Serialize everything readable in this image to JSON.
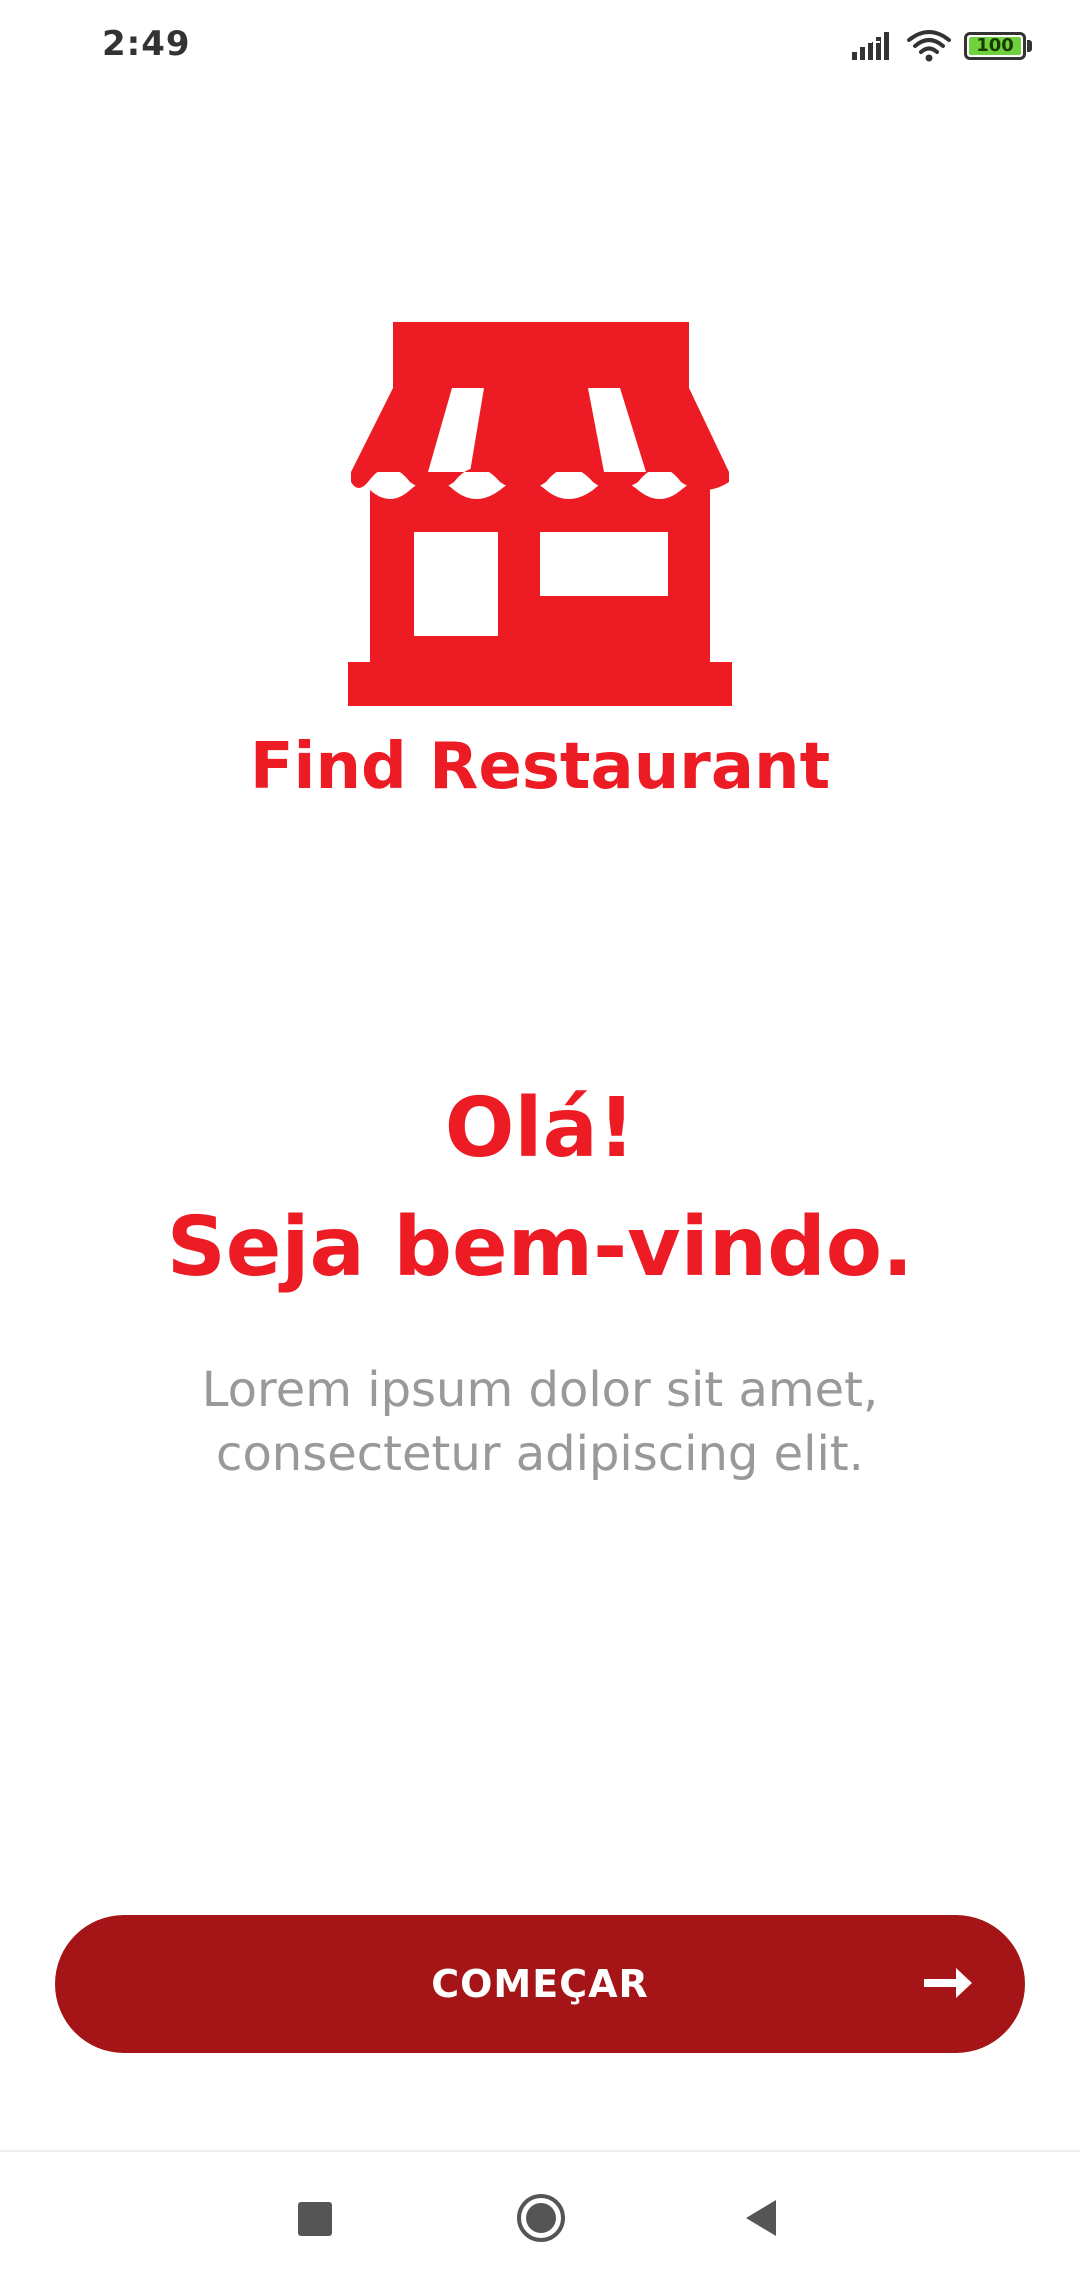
{
  "status_bar": {
    "time": "2:49",
    "battery_level": "100",
    "icons": [
      "signal-icon",
      "wifi-icon",
      "battery-icon"
    ]
  },
  "logo": {
    "icon": "storefront-icon",
    "title": "Find Restaurant"
  },
  "welcome": {
    "line1": "Olá!",
    "line2": "Seja bem-vindo.",
    "subtitle": "Lorem ipsum dolor sit amet, consectetur adipiscing elit."
  },
  "cta": {
    "label": "COMEÇAR",
    "icon": "arrow-right-icon"
  },
  "nav_bar": {
    "icons": [
      "recent-apps-icon",
      "home-icon",
      "back-icon"
    ]
  },
  "colors": {
    "brand_red": "#ed1c24",
    "button_red": "#a51417",
    "subtitle_gray": "#999999"
  }
}
